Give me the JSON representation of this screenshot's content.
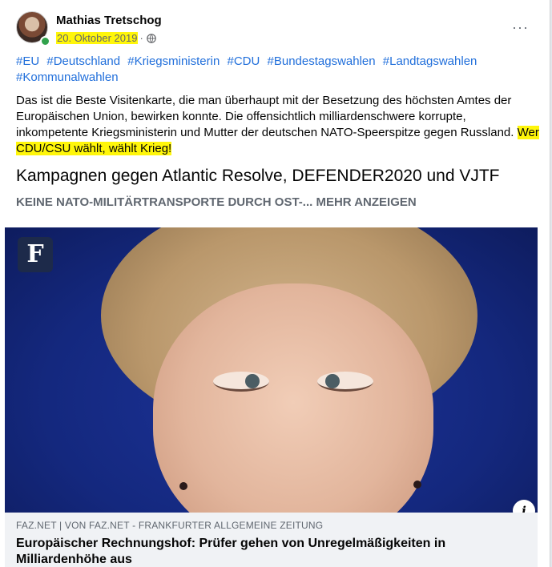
{
  "post": {
    "author": "Mathias Tretschog",
    "date": "20. Oktober 2019",
    "separator": "·",
    "privacy_icon": "globe-icon",
    "more_icon": "···",
    "hashtags": [
      "#EU",
      "#Deutschland",
      "#Kriegsministerin",
      "#CDU",
      "#Bundestagswahlen",
      "#Landtagswahlen",
      "#Kommunalwahlen"
    ],
    "text_main": "Das ist die Beste Visitenkarte, die man überhaupt mit der Besetzung des höchsten Amtes der Europäischen Union, bewirken konnte. Die offensichtlich milliardenschwere korrupte, inkompetente Kriegsministerin und Mutter der deutschen NATO-Speerspitze gegen Russland.",
    "text_highlight": "Wer CDU/CSU wählt, wählt Krieg!",
    "link_title": "Kampagnen gegen Atlantic Resolve, DEFENDER2020 und VJTF",
    "link_subtitle": "KEINE NATO-MILITÄRTRANSPORTE DURCH OST-...",
    "more_label": "MEHR ANZEIGEN",
    "highlight_color": "#fff60a"
  },
  "link_preview": {
    "logo_letter": "F",
    "info_label": "i",
    "source": "FAZ.NET | VON FAZ.NET - FRANKFURTER ALLGEMEINE ZEITUNG",
    "title": "Europäischer Rechnungshof: Prüfer gehen von Unregelmäßigkeiten in Milliardenhöhe aus"
  }
}
